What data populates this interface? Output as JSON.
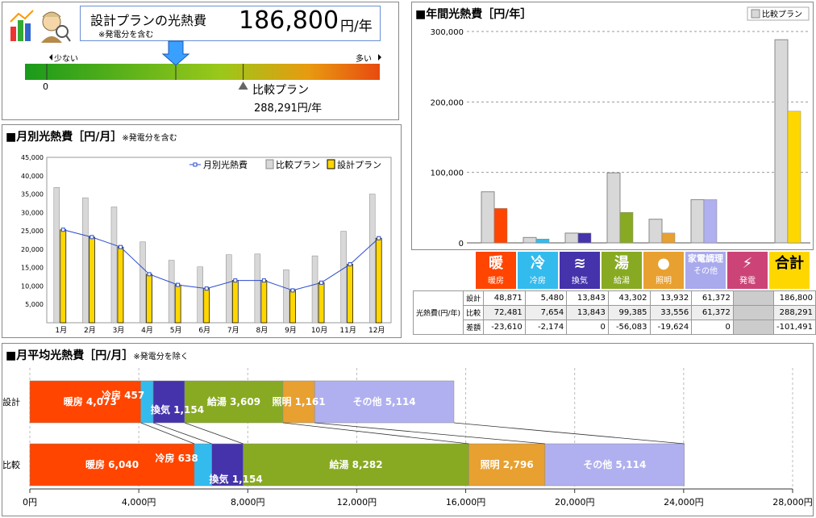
{
  "summary": {
    "title": "設計プランの光熱費",
    "note": "※発電分を含む",
    "value": "186,800",
    "unit": "円/年",
    "scale_left": "少ない",
    "scale_right": "多い",
    "scale_zero": "0",
    "design_fraction": 0.425,
    "compare_fraction": 0.615,
    "compare_label": "比較プラン",
    "compare_value": "288,291円/年"
  },
  "monthly": {
    "title": "■月別光熱費［円/月］",
    "note": "※発電分を含む",
    "legend": [
      "月別光熱費",
      "比較プラン",
      "設計プラン"
    ]
  },
  "annual": {
    "title": "■年間光熱費［円/年］",
    "legend": "比較プラン"
  },
  "table": {
    "categories": [
      {
        "icon": "暖",
        "label": "暖房",
        "color": "#ff4500"
      },
      {
        "icon": "冷",
        "label": "冷房",
        "color": "#33bbee"
      },
      {
        "icon": "≋",
        "label": "換気",
        "color": "#4433aa"
      },
      {
        "icon": "湯",
        "label": "給湯",
        "color": "#88aa22"
      },
      {
        "icon": "●",
        "label": "照明",
        "color": "#e8a030"
      },
      {
        "icon": "家電調理",
        "label": "その他",
        "color": "#a9a9ee"
      },
      {
        "icon": "⚡",
        "label": "発電",
        "color": "#cc4477"
      },
      {
        "icon": "合計",
        "label": "",
        "color": "#ffd700"
      }
    ],
    "row_header": "光熱費(円/年)",
    "rows": [
      {
        "label": "設計",
        "values": [
          "48,871",
          "5,480",
          "13,843",
          "43,302",
          "13,932",
          "61,372",
          "",
          "186,800"
        ]
      },
      {
        "label": "比較",
        "values": [
          "72,481",
          "7,654",
          "13,843",
          "99,385",
          "33,556",
          "61,372",
          "",
          "288,291"
        ]
      },
      {
        "label": "差額",
        "values": [
          "-23,610",
          "-2,174",
          "0",
          "-56,083",
          "-19,624",
          "0",
          "",
          "-101,491"
        ]
      }
    ]
  },
  "average": {
    "title": "■月平均光熱費［円/月］",
    "note": "※発電分を除く",
    "row_labels": [
      "設計",
      "比較"
    ]
  },
  "colors": {
    "heat": "#ff4500",
    "cool": "#33bbee",
    "vent": "#4433aa",
    "water": "#88aa22",
    "light": "#e8a030",
    "other": "#b0b0f0",
    "design": "#ffd700",
    "compare": "#d8d8d8"
  },
  "chart_data": [
    {
      "type": "bar",
      "name": "monthly",
      "categories": [
        "1月",
        "2月",
        "3月",
        "4月",
        "5月",
        "6月",
        "7月",
        "8月",
        "9月",
        "10月",
        "11月",
        "12月"
      ],
      "series": [
        {
          "name": "比較プラン",
          "values": [
            36800,
            34000,
            31500,
            22000,
            17000,
            15200,
            18500,
            18700,
            14400,
            18200,
            24900,
            35000
          ]
        },
        {
          "name": "設計プラン",
          "values": [
            25300,
            23300,
            20600,
            13200,
            10300,
            9300,
            11500,
            11500,
            8800,
            10900,
            15900,
            23000
          ]
        },
        {
          "name": "月別光熱費",
          "values": [
            25300,
            23300,
            20600,
            13200,
            10300,
            9300,
            11500,
            11500,
            8800,
            10900,
            15900,
            23000
          ]
        }
      ],
      "yticks": [
        "5,000",
        "10,000",
        "15,000",
        "20,000",
        "25,000",
        "30,000",
        "35,000",
        "40,000",
        "45,000"
      ],
      "ylim": [
        0,
        45000
      ]
    },
    {
      "type": "bar",
      "name": "annual",
      "categories": [
        "暖房",
        "冷房",
        "換気",
        "給湯",
        "照明",
        "その他",
        "発電",
        "合計"
      ],
      "series": [
        {
          "name": "比較プラン",
          "values": [
            72481,
            7654,
            13843,
            99385,
            33556,
            61372,
            0,
            288291
          ]
        },
        {
          "name": "設計",
          "values": [
            48871,
            5480,
            13843,
            43302,
            13932,
            61372,
            0,
            186800
          ]
        }
      ],
      "yticks": [
        "0",
        "100,000",
        "200,000",
        "300,000"
      ],
      "ylim": [
        0,
        300000
      ]
    },
    {
      "type": "bar",
      "name": "average",
      "orientation": "horizontal",
      "stacked": true,
      "xticks": [
        "0円",
        "4,000円",
        "8,000円",
        "12,000円",
        "16,000円",
        "20,000円",
        "24,000円",
        "28,000円"
      ],
      "xlim": [
        0,
        28000
      ],
      "rows": [
        {
          "label": "設計",
          "segments": [
            {
              "name": "暖房",
              "value": 4073,
              "text": "暖房 4,073"
            },
            {
              "name": "冷房",
              "value": 457,
              "text": "冷房 457"
            },
            {
              "name": "換気",
              "value": 1154,
              "text": "換気 1,154"
            },
            {
              "name": "給湯",
              "value": 3609,
              "text": "給湯 3,609"
            },
            {
              "name": "照明",
              "value": 1161,
              "text": "照明 1,161"
            },
            {
              "name": "その他",
              "value": 5114,
              "text": "その他 5,114"
            }
          ]
        },
        {
          "label": "比較",
          "segments": [
            {
              "name": "暖房",
              "value": 6040,
              "text": "暖房 6,040"
            },
            {
              "name": "冷房",
              "value": 638,
              "text": "冷房 638"
            },
            {
              "name": "換気",
              "value": 1154,
              "text": "換気 1,154"
            },
            {
              "name": "給湯",
              "value": 8282,
              "text": "給湯 8,282"
            },
            {
              "name": "照明",
              "value": 2796,
              "text": "照明 2,796"
            },
            {
              "name": "その他",
              "value": 5114,
              "text": "その他 5,114"
            }
          ]
        }
      ]
    }
  ]
}
